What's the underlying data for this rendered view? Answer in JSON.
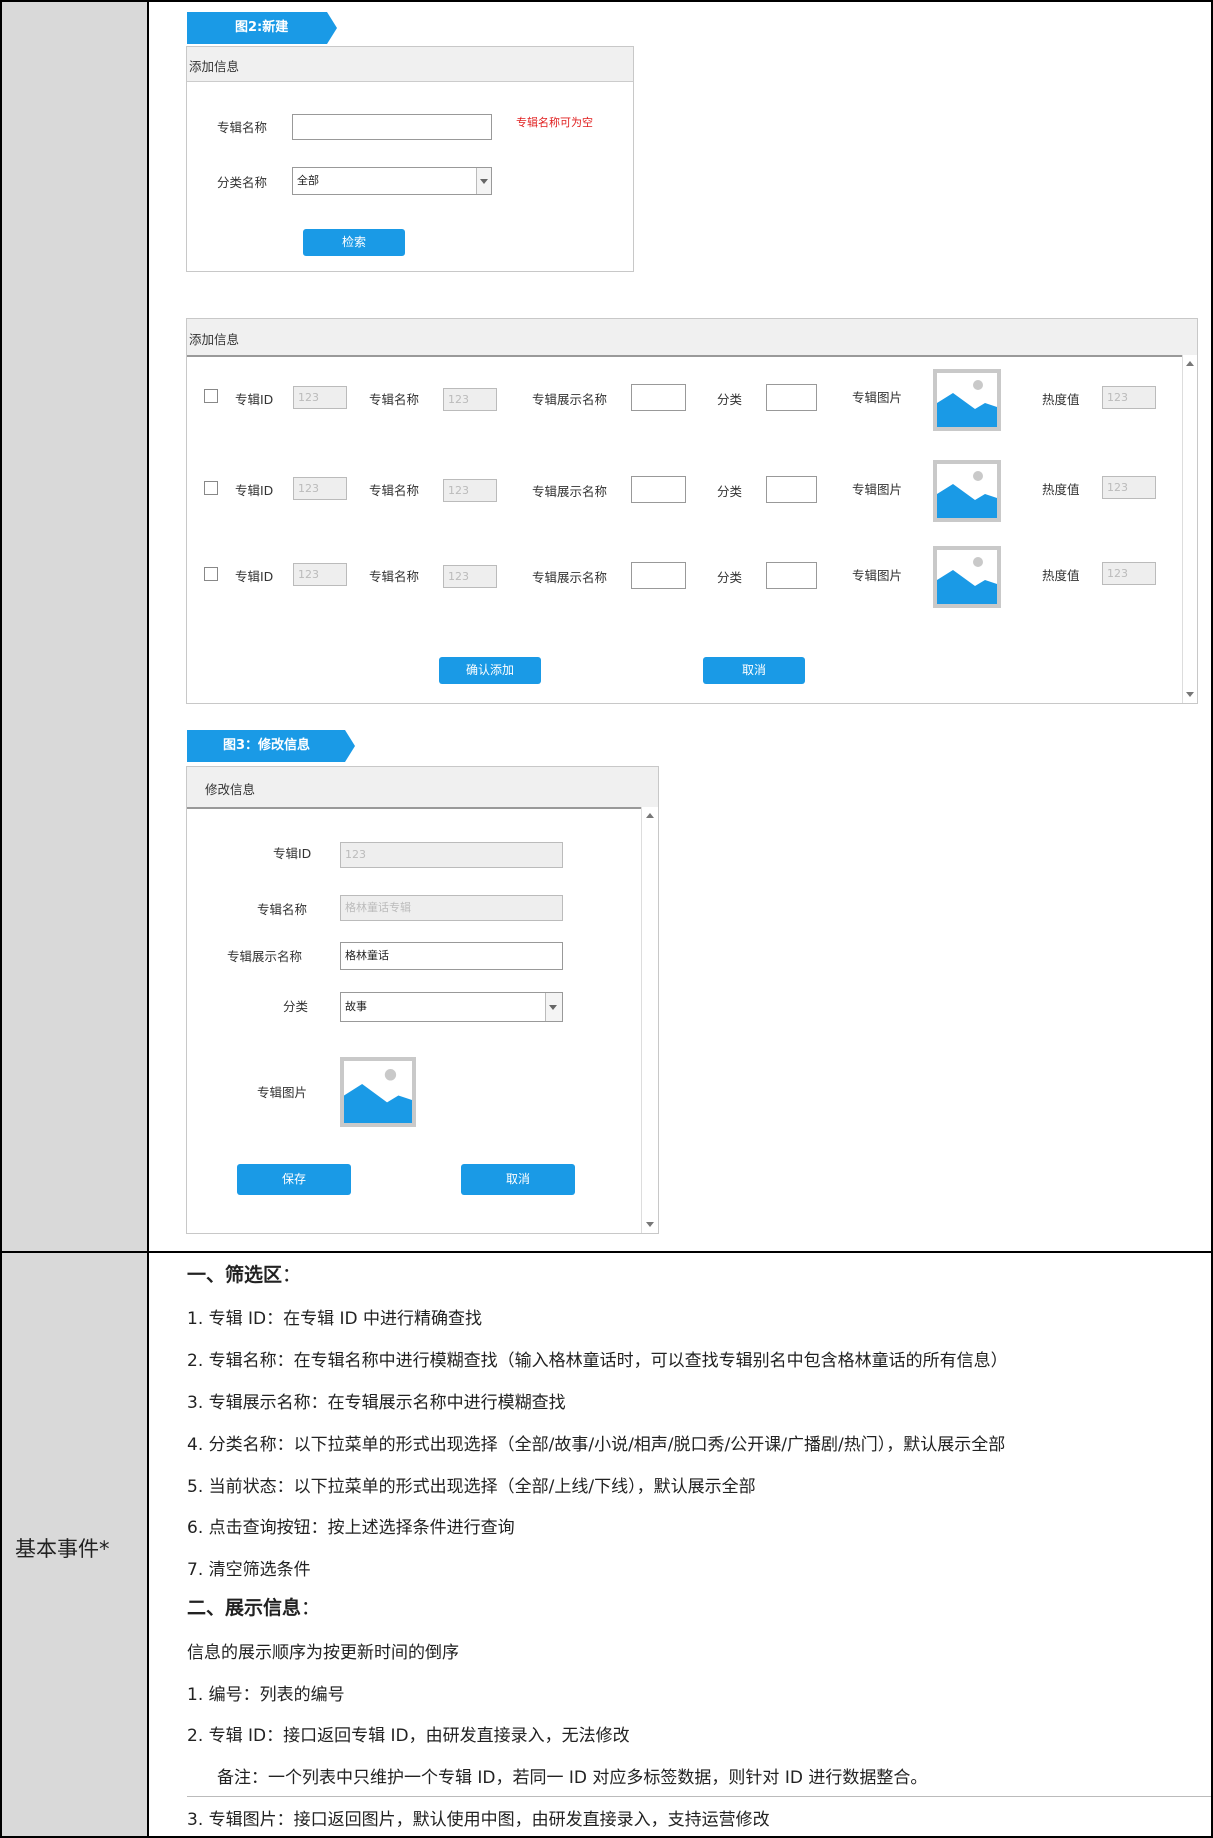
{
  "fig2": {
    "tag": "图2:新建",
    "filter_panel": {
      "title": "添加信息",
      "album_name_label": "专辑名称",
      "album_name_value": "",
      "album_name_hint": "专辑名称可为空",
      "category_label": "分类名称",
      "category_value": "全部",
      "search_button": "检索"
    },
    "list_panel": {
      "title": "添加信息",
      "rows": [
        {
          "id_label": "专辑ID",
          "id_value": "123",
          "name_label": "专辑名称",
          "name_value": "123",
          "display_label": "专辑展示名称",
          "display_value": "",
          "cat_label": "分类",
          "cat_value": "",
          "img_label": "专辑图片",
          "heat_label": "热度值",
          "heat_value": "123"
        },
        {
          "id_label": "专辑ID",
          "id_value": "123",
          "name_label": "专辑名称",
          "name_value": "123",
          "display_label": "专辑展示名称",
          "display_value": "",
          "cat_label": "分类",
          "cat_value": "",
          "img_label": "专辑图片",
          "heat_label": "热度值",
          "heat_value": "123"
        },
        {
          "id_label": "专辑ID",
          "id_value": "123",
          "name_label": "专辑名称",
          "name_value": "123",
          "display_label": "专辑展示名称",
          "display_value": "",
          "cat_label": "分类",
          "cat_value": "",
          "img_label": "专辑图片",
          "heat_label": "热度值",
          "heat_value": "123"
        }
      ],
      "confirm_button": "确认添加",
      "cancel_button": "取消"
    }
  },
  "fig3": {
    "tag": "图3：修改信息",
    "panel": {
      "title": "修改信息",
      "id_label": "专辑ID",
      "id_value": "123",
      "name_label": "专辑名称",
      "name_value": "格林童话专辑",
      "display_label": "专辑展示名称",
      "display_value": "格林童话",
      "cat_label": "分类",
      "cat_value": "故事",
      "img_label": "专辑图片",
      "save_button": "保存",
      "cancel_button": "取消"
    }
  },
  "events": {
    "row_label": "基本事件*",
    "lines": [
      {
        "bold": "一、筛选区",
        "rest": "："
      },
      {
        "bold": "",
        "rest": "1. 专辑 ID：在专辑 ID 中进行精确查找"
      },
      {
        "bold": "",
        "rest": "2. 专辑名称：在专辑名称中进行模糊查找（输入格林童话时，可以查找专辑别名中包含格林童话的所有信息）"
      },
      {
        "bold": "",
        "rest": "3. 专辑展示名称：在专辑展示名称中进行模糊查找"
      },
      {
        "bold": "",
        "rest": "4. 分类名称：以下拉菜单的形式出现选择（全部/故事/小说/相声/脱口秀/公开课/广播剧/热门），默认展示全部"
      },
      {
        "bold": "",
        "rest": "5. 当前状态：以下拉菜单的形式出现选择（全部/上线/下线），默认展示全部"
      },
      {
        "bold": "",
        "rest": "6. 点击查询按钮：按上述选择条件进行查询"
      },
      {
        "bold": "",
        "rest": "7. 清空筛选条件"
      },
      {
        "bold": "二、展示信息",
        "rest": "："
      },
      {
        "bold": "",
        "rest": "信息的展示顺序为按更新时间的倒序"
      },
      {
        "bold": "",
        "rest": "1. 编号：列表的编号"
      },
      {
        "bold": "",
        "rest": "2. 专辑 ID：接口返回专辑 ID，由研发直接录入，无法修改"
      },
      {
        "bold": "",
        "rest": "备注：一个列表中只维护一个专辑 ID，若同一 ID 对应多标签数据，则针对 ID 进行数据整合。"
      },
      {
        "bold": "",
        "rest": "3. 专辑图片：接口返回图片，默认使用中图，由研发直接录入，支持运营修改"
      }
    ]
  },
  "colors": {
    "accent": "#1a9ae6",
    "hint_red": "#e02020",
    "side_gray": "#d9d9d9"
  }
}
